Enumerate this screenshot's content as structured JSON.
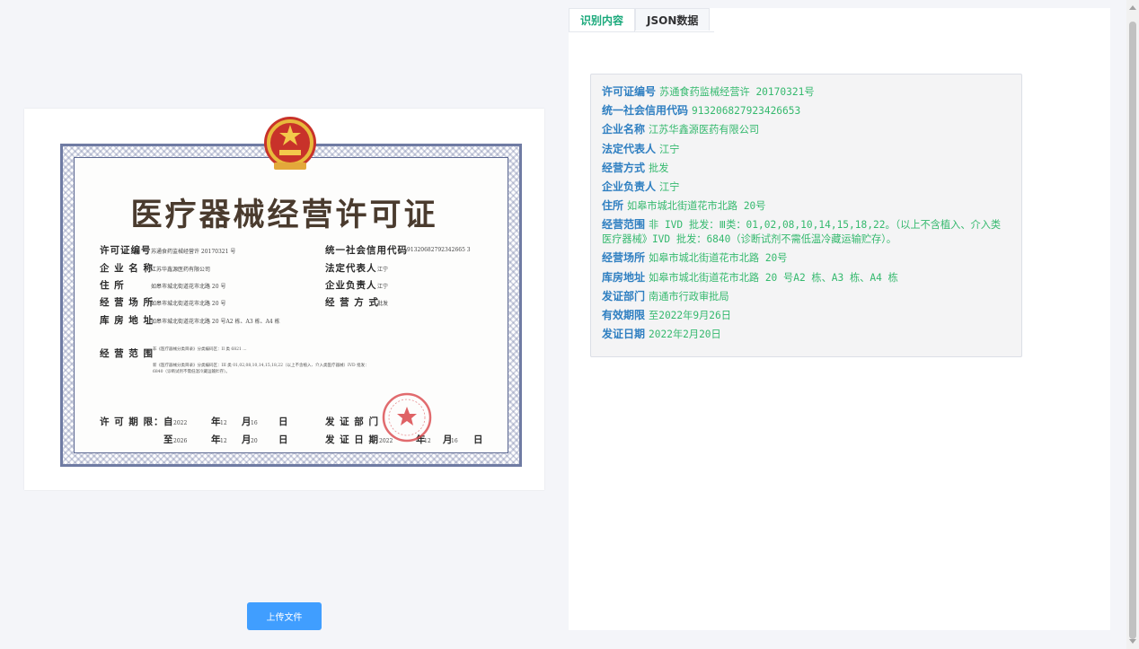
{
  "certificate": {
    "title": "医疗器械经营许可证",
    "labels": {
      "license_no": "许可证编号",
      "credit_code": "统一社会信用代码",
      "company": "企 业 名 称",
      "legal_rep": "法定代表人",
      "residence": "住    所",
      "principal": "企业负责人",
      "premises": "经 营 场 所",
      "mode": "经 营 方 式",
      "warehouse": "库 房 地 址",
      "scope": "经 营 范 围",
      "validity": "许 可 期 限：",
      "authority": "发 证 部 门",
      "issue_date": "发 证 日 期"
    },
    "values": {
      "license_no": "苏通食药监械经营许 20170321 号",
      "credit_code": "91320682792342665 3",
      "company": "江苏华鑫源医药有限公司",
      "legal_rep": "江宁",
      "residence": "如皋市城北街道花市北路 20 号",
      "principal": "江宁",
      "premises": "如皋市城北街道花市北路 20 号",
      "mode": "批发",
      "warehouse": "如皋市城北街道花市北路 20 号A2 栋、A3 栋、A4 栋",
      "scope_line1": "非《医疗器械分类目录》分类编码区：II 类 6821 ...",
      "scope_line2": "新《医疗器械分类目录》分类编码区：III 类 01,02,08,10,14,15,18,22（以上不含植入、介入类医疗器械）IVD 批发：",
      "scope_line3": "6840（诊断试剂不需低温冷藏运输贮存）。",
      "from": "自",
      "to": "至",
      "from_year": "2022",
      "to_year": "2026",
      "nian": "年",
      "yue": "月",
      "ri": "日",
      "from_month": "12",
      "from_day": "16",
      "to_month": "12",
      "to_day": "20",
      "issue_year": "2022",
      "issue_month": "12",
      "issue_day": "16"
    }
  },
  "upload_button": {
    "label": "上传文件"
  },
  "tabs": [
    {
      "label": "识别内容",
      "active": true
    },
    {
      "label": "JSON数据",
      "active": false
    }
  ],
  "result": {
    "fields": [
      {
        "key": "许可证编号",
        "value": "苏通食药监械经营许 20170321号"
      },
      {
        "key": "统一社会信用代码",
        "value": "913206827923426653"
      },
      {
        "key": "企业名称",
        "value": "江苏华鑫源医药有限公司"
      },
      {
        "key": "法定代表人",
        "value": "江宁"
      },
      {
        "key": "经营方式",
        "value": "批发"
      },
      {
        "key": "企业负责人",
        "value": "江宁"
      },
      {
        "key": "住所",
        "value": "如皋市城北街道花市北路 20号"
      },
      {
        "key": "经营范围",
        "value": "非 IVD 批发：Ⅲ类：01,02,08,10,14,15,18,22。（以上不含植入、介入类医疗器械》IVD 批发：6840（诊断试剂不需低温冷藏运输贮存）。"
      },
      {
        "key": "经营场所",
        "value": "如皋市城北街道花市北路 20号"
      },
      {
        "key": "库房地址",
        "value": "如皋市城北街道花市北路 20 号A2 栋、A3 栋、A4 栋"
      },
      {
        "key": "发证部门",
        "value": "南通市行政审批局"
      },
      {
        "key": "有效期限",
        "value": "至2022年9月26日"
      },
      {
        "key": "发证日期",
        "value": "2022年2月20日"
      }
    ]
  },
  "colors": {
    "accent": "#409eff",
    "key_text": "#2f7fc1",
    "value_text": "#35b96e",
    "active_tab": "#1aa97b"
  }
}
